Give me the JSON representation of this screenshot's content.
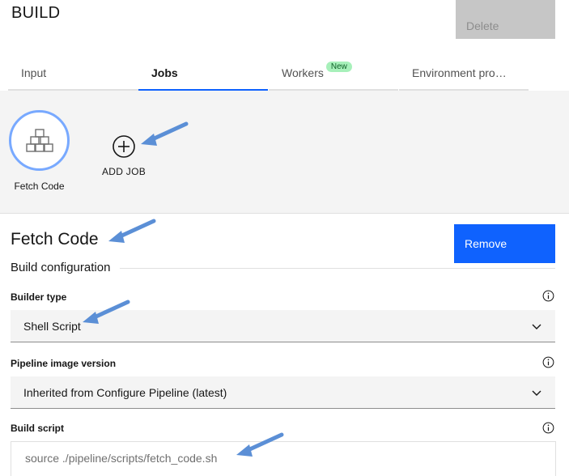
{
  "header": {
    "title": "BUILD",
    "delete_label": "Delete"
  },
  "tabs": [
    {
      "label": "Input"
    },
    {
      "label": "Jobs",
      "active": true
    },
    {
      "label": "Workers",
      "badge": "New"
    },
    {
      "label": "Environment pro…"
    }
  ],
  "jobs": {
    "items": [
      {
        "label": "Fetch Code",
        "icon": "stacked-boxes-icon"
      }
    ],
    "add_label": "ADD JOB"
  },
  "job_detail": {
    "title": "Fetch Code",
    "remove_label": "Remove",
    "section_heading": "Build configuration",
    "builder_type": {
      "label": "Builder type",
      "value": "Shell Script"
    },
    "pipeline_image": {
      "label": "Pipeline image version",
      "value": "Inherited from Configure Pipeline (latest)"
    },
    "build_script": {
      "label": "Build script",
      "value": "source ./pipeline/scripts/fetch_code.sh"
    }
  },
  "colors": {
    "primary": "#0f62fe",
    "disabled": "#c6c6c6",
    "badge_bg": "#a7f0ba",
    "annotation_arrow": "#5b8fd6"
  }
}
